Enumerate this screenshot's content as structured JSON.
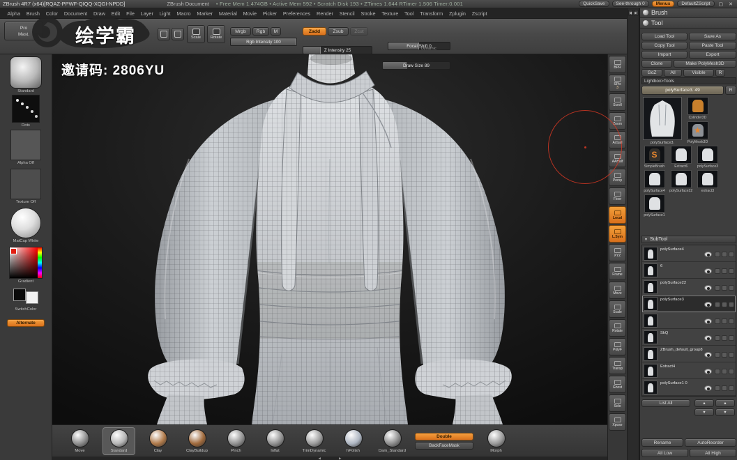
{
  "icons": {
    "win_max": "▢",
    "win_close": "✕",
    "up": "▲",
    "down": "▼",
    "left": "◀",
    "right": "▶",
    "tri_down": "▼",
    "tri_right": "▶"
  },
  "titlebar": {
    "app_title": "ZBrush 4R7 (x64)[RQAZ-PPWF-QIQQ-XQGI-NPDD]",
    "doc_title": "ZBrush Document",
    "stats": "• Free Mem 1.474GB • Active Mem 592 • Scratch Disk 193 • ZTimes 1.644 RTimer 1.506 Timer:0.001",
    "quicksave": "QuickSave",
    "see_through": "See-through 0",
    "menus": "Menus",
    "default_zscript": "DefaultZScript"
  },
  "menubar": {
    "items": [
      "Alpha",
      "Brush",
      "Color",
      "Document",
      "Draw",
      "Edit",
      "File",
      "Layer",
      "Light",
      "Macro",
      "Marker",
      "Material",
      "Movie",
      "Picker",
      "Preferences",
      "Render",
      "Stencil",
      "Stroke",
      "Texture",
      "Tool",
      "Transform",
      "Zplugin",
      "Zscript"
    ]
  },
  "topshelf": {
    "projection_master_line1": "Pro",
    "projection_master_line2": "Mast.",
    "scale_label": "Scale",
    "rotate_label": "Rotate",
    "mrgb": "Mrgb",
    "rgb": "Rgb",
    "m": "M",
    "rgb_intensity": "Rgb Intensity 100",
    "zadd": "Zadd",
    "zsub": "Zsub",
    "zcut": "Zcut",
    "z_intensity": "Z Intensity 25",
    "focal_shift": "Focal Shift 0",
    "draw_size": "Draw Size 89",
    "dynamic_label": "Dynamic"
  },
  "watermark": {
    "brand": "绘学霸",
    "invite": "邀请码: 2806YU"
  },
  "leftshelf": {
    "brush_label": "Standard",
    "stroke_label": "Dots",
    "alpha_label": "Alpha Off",
    "texture_label": "Texture Off",
    "material_label": "MatCap White",
    "gradient_label": "Gradient",
    "switch_label": "SwitchColor",
    "alternate_label": "Alternate"
  },
  "rightstrip": {
    "items": [
      {
        "label": "BPR"
      },
      {
        "label": "SPix",
        "badge": "3"
      },
      {
        "label": "Scroll"
      },
      {
        "label": "Zoom"
      },
      {
        "label": "Actual"
      },
      {
        "label": "AAHalf"
      },
      {
        "label": "Persp"
      },
      {
        "label": "Floor"
      },
      {
        "label": "Local",
        "active": true
      },
      {
        "label": "L.Sym",
        "active": true
      },
      {
        "label": "XYZ"
      },
      {
        "label": "Frame"
      },
      {
        "label": "Move"
      },
      {
        "label": "Scale"
      },
      {
        "label": "Rotate"
      },
      {
        "label": "PolyF"
      },
      {
        "label": "Transp"
      },
      {
        "label": "Ghost"
      },
      {
        "label": "Solo"
      },
      {
        "label": "Xpose"
      }
    ]
  },
  "tool_panel": {
    "brush_header": "Brush",
    "tool_header": "Tool",
    "load_tool": "Load Tool",
    "save_as": "Save As",
    "copy_tool": "Copy Tool",
    "paste_tool": "Paste Tool",
    "import_btn": "Import",
    "export_btn": "Export",
    "clone_btn": "Clone",
    "make_polymesh": "Make PolyMesh3D",
    "goz": "GoZ",
    "all_btn": "All",
    "visible_btn": "Visible",
    "r_btn": "R",
    "lightbox_tools": "Lightbox>Tools",
    "current_tool": "polySurface3. 49",
    "current_tool_r": "R",
    "active_thumb_label": "polySurface3.",
    "thumbs": [
      {
        "name": "Cylinder3D",
        "c": "#c9802c",
        "glyph": ""
      },
      {
        "name": "PolyMesh3D",
        "c": "#8d9196",
        "glyph": "★"
      },
      {
        "name": "SimpleBrush",
        "c": "#34312d",
        "glyph": "S"
      },
      {
        "name": "Extract6",
        "c": "#dfe1e3",
        "glyph": ""
      },
      {
        "name": "polySurface3",
        "c": "#dfe1e3",
        "glyph": ""
      },
      {
        "name": "polySurface4",
        "c": "#dfe1e3",
        "glyph": ""
      },
      {
        "name": "polySurface22",
        "c": "#dfe1e3",
        "glyph": ""
      },
      {
        "name": "extract3",
        "c": "#dfe1e3",
        "glyph": ""
      },
      {
        "name": "polySurface1",
        "c": "#dfe1e3",
        "glyph": ""
      }
    ],
    "subtool": {
      "header": "SubTool",
      "rows": [
        {
          "name": "polySurface4"
        },
        {
          "name": "6"
        },
        {
          "name": "polySurface22"
        },
        {
          "name": "polySurface3",
          "sel": true
        },
        {
          "name": ""
        },
        {
          "name": "SkQ"
        },
        {
          "name": "ZBrush_default_group8"
        },
        {
          "name": "Extract4"
        },
        {
          "name": "polySurface1 0"
        }
      ],
      "list_all": "List All",
      "rename": "Rename",
      "autoreorder": "AutoReorder",
      "all_low": "All Low",
      "all_high": "All High"
    }
  },
  "bottomtray": {
    "brushes": [
      {
        "name": "Move",
        "color": "#8e8e8e"
      },
      {
        "name": "Standard",
        "color": "#b5b5b5",
        "sel": true
      },
      {
        "name": "Clay",
        "color": "#b07a4a"
      },
      {
        "name": "ClayBuildup",
        "color": "#a06a3c"
      },
      {
        "name": "Pinch",
        "color": "#929292"
      },
      {
        "name": "Inflat",
        "color": "#929292"
      },
      {
        "name": "TrimDynamic",
        "color": "#9c9c9c"
      },
      {
        "name": "hPolish",
        "color": "#aeb6c2"
      },
      {
        "name": "Dam_Standard",
        "color": "#8e8e8e"
      }
    ],
    "double_label": "Double",
    "backface_label": "BackFaceMask",
    "morph_label": "Morph"
  }
}
